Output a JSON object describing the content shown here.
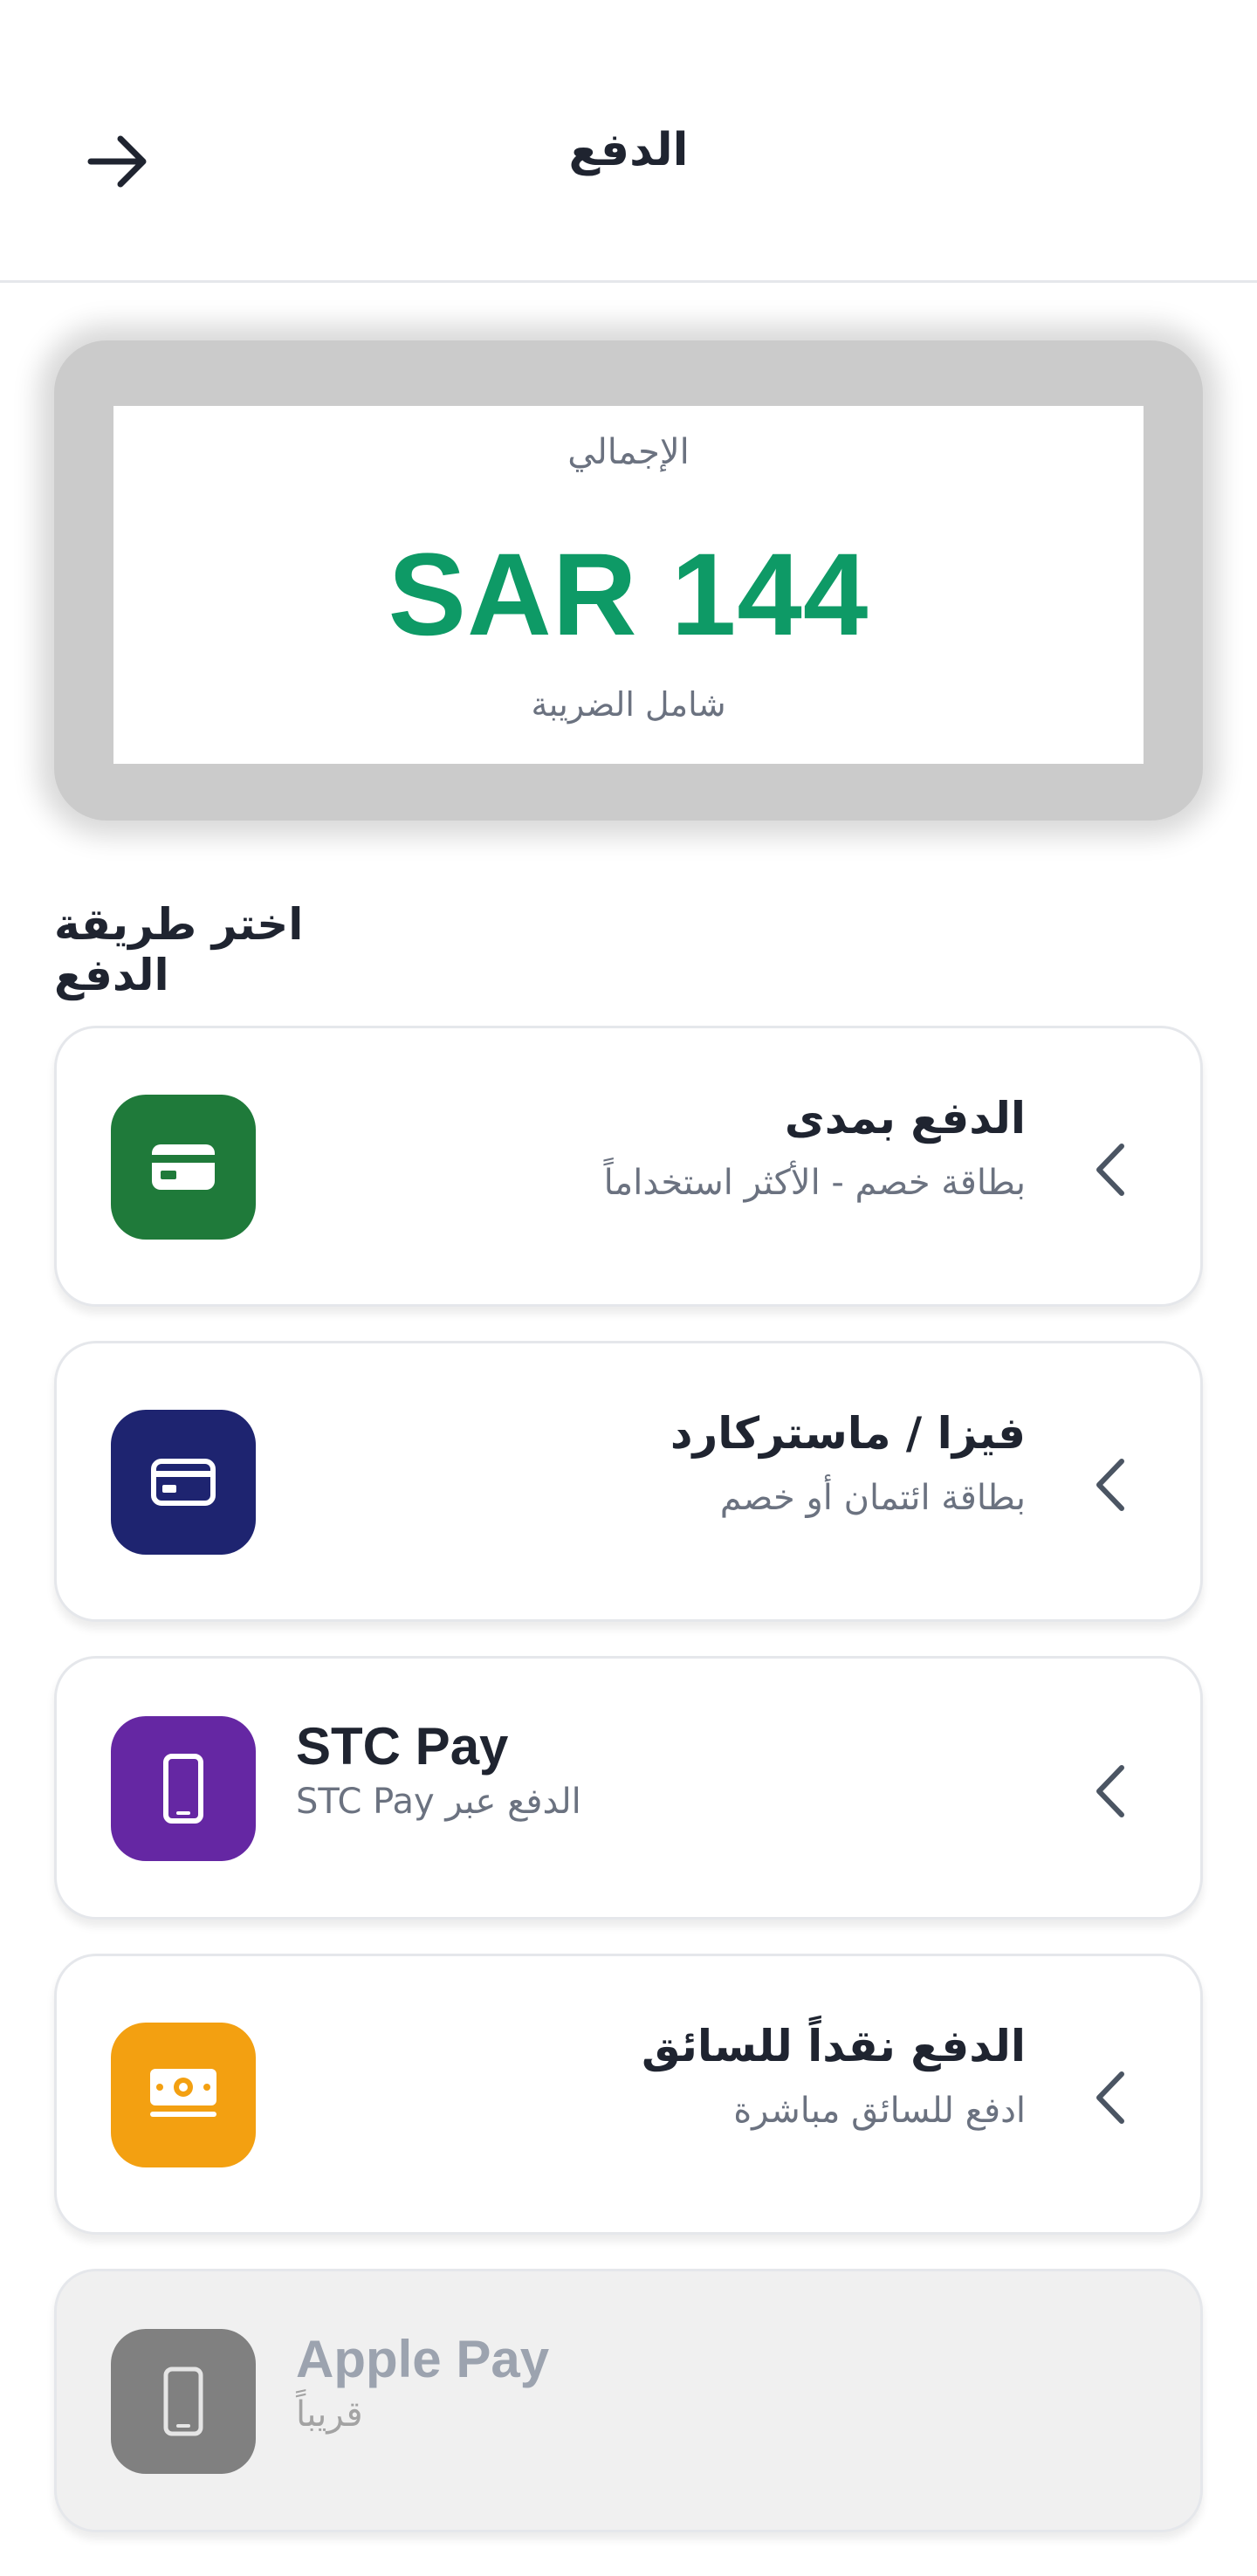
{
  "header": {
    "title": "الدفع",
    "back_icon": "arrow-right-icon"
  },
  "total": {
    "label": "الإجمالي",
    "amount": "SAR 144",
    "note": "شامل الضريبة",
    "accent": "#0e9a66"
  },
  "section_title": "اختر طريقة الدفع",
  "methods": [
    {
      "title": "الدفع بمدى",
      "subtitle": "بطاقة خصم - الأكثر استخداماً",
      "icon": "credit-card-icon",
      "color": "#1f7a3a"
    },
    {
      "title": "فيزا / ماستركارد",
      "subtitle": "بطاقة ائتمان أو خصم",
      "icon": "credit-card-icon",
      "color": "#1e2470"
    },
    {
      "title": "STC Pay",
      "subtitle": "الدفع عبر STC Pay",
      "icon": "phone-icon",
      "color": "#6527a3"
    },
    {
      "title": "الدفع نقداً للسائق",
      "subtitle": "ادفع للسائق مباشرة",
      "icon": "cash-icon",
      "color": "#f3a011"
    },
    {
      "title": "Apple Pay",
      "subtitle": "قريباً",
      "icon": "phone-icon",
      "color": "#808080"
    }
  ]
}
